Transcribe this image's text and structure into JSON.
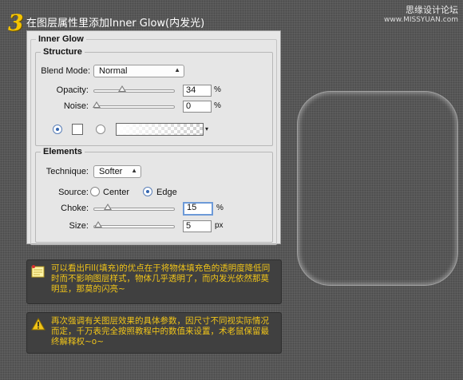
{
  "header": {
    "step_number": "3",
    "title": "在图层属性里添加Inner Glow(内发光)",
    "watermark_line1": "思缘设计论坛",
    "watermark_line2": "www.MISSYUAN.com"
  },
  "dialog": {
    "title": "Inner Glow",
    "structure": {
      "label": "Structure",
      "blend_mode_label": "Blend Mode:",
      "blend_mode_value": "Normal",
      "opacity_label": "Opacity:",
      "opacity_value": "34",
      "opacity_unit": "%",
      "opacity_level": 0.34,
      "noise_label": "Noise:",
      "noise_value": "0",
      "noise_unit": "%",
      "noise_level": 0,
      "color_mode": "solid-color",
      "glow_color": "#ffffff"
    },
    "elements": {
      "label": "Elements",
      "technique_label": "Technique:",
      "technique_value": "Softer",
      "source_label": "Source:",
      "source_center_label": "Center",
      "source_edge_label": "Edge",
      "source_selected": "Edge",
      "choke_label": "Choke:",
      "choke_value": "15",
      "choke_unit": "%",
      "choke_level": 0.15,
      "size_label": "Size:",
      "size_value": "5",
      "size_unit": "px",
      "size_level": 0.02
    }
  },
  "notes": [
    {
      "icon": "note-icon",
      "text": "可以看出Fill(填充)的优点在于将物体填充色的透明度降低同时而不影响图层样式，物体几乎透明了，而内发光依然那莫明显，那莫的闪亮~"
    },
    {
      "icon": "warning-icon",
      "text": "再次强调有关图层效果的具体参数，因尺寸不同视实际情况而定，千万表完全按照教程中的数值来设置，术老鼠保留最终解释权~o~"
    }
  ],
  "colors": {
    "accent_yellow": "#f0c419",
    "step_number": "#f5c400",
    "background": "#5c5c5c",
    "panel": "#e6e6e6"
  }
}
